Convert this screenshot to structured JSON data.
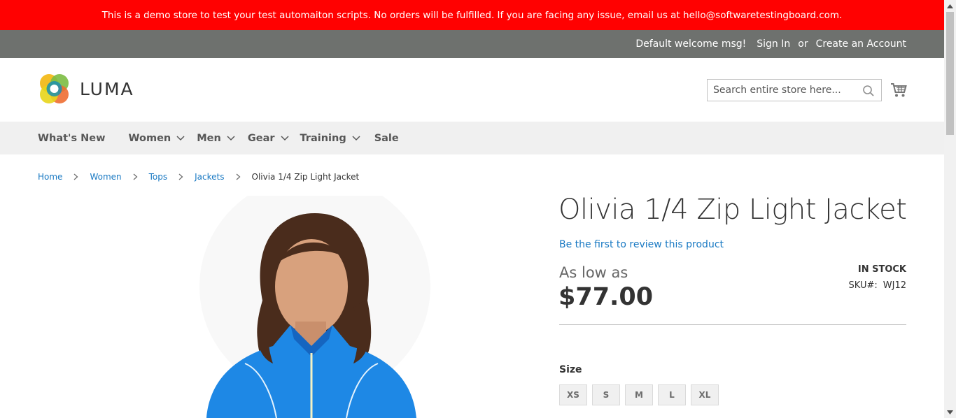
{
  "demo_notice": "This is a demo store to test your test automaiton scripts. No orders will be fulfilled. If you are facing any issue, email us at hello@softwaretestingboard.com.",
  "header_links": {
    "welcome": "Default welcome msg!",
    "sign_in": "Sign In",
    "or": "or",
    "create_account": "Create an Account"
  },
  "logo": {
    "text": "LUMA"
  },
  "search": {
    "placeholder": "Search entire store here..."
  },
  "nav": {
    "items": [
      {
        "label": "What's New",
        "has_dropdown": false
      },
      {
        "label": "Women",
        "has_dropdown": true
      },
      {
        "label": "Men",
        "has_dropdown": true
      },
      {
        "label": "Gear",
        "has_dropdown": true
      },
      {
        "label": "Training",
        "has_dropdown": true
      },
      {
        "label": "Sale",
        "has_dropdown": false
      }
    ]
  },
  "breadcrumbs": {
    "items": [
      "Home",
      "Women",
      "Tops",
      "Jackets"
    ],
    "current": "Olivia 1/4 Zip Light Jacket"
  },
  "product": {
    "title": "Olivia 1/4 Zip Light Jacket",
    "review_link": "Be the first to review this product",
    "as_low_as": "As low as",
    "price": "$77.00",
    "stock": "IN STOCK",
    "sku_label": "SKU#:",
    "sku": "WJ12",
    "size_label": "Size",
    "sizes": [
      "XS",
      "S",
      "M",
      "L",
      "XL"
    ]
  },
  "colors": {
    "demo_bar": "#ff0101",
    "header_links_bar": "#6e716e",
    "link": "#1979c3",
    "nav_bg": "#f0f0f0"
  }
}
